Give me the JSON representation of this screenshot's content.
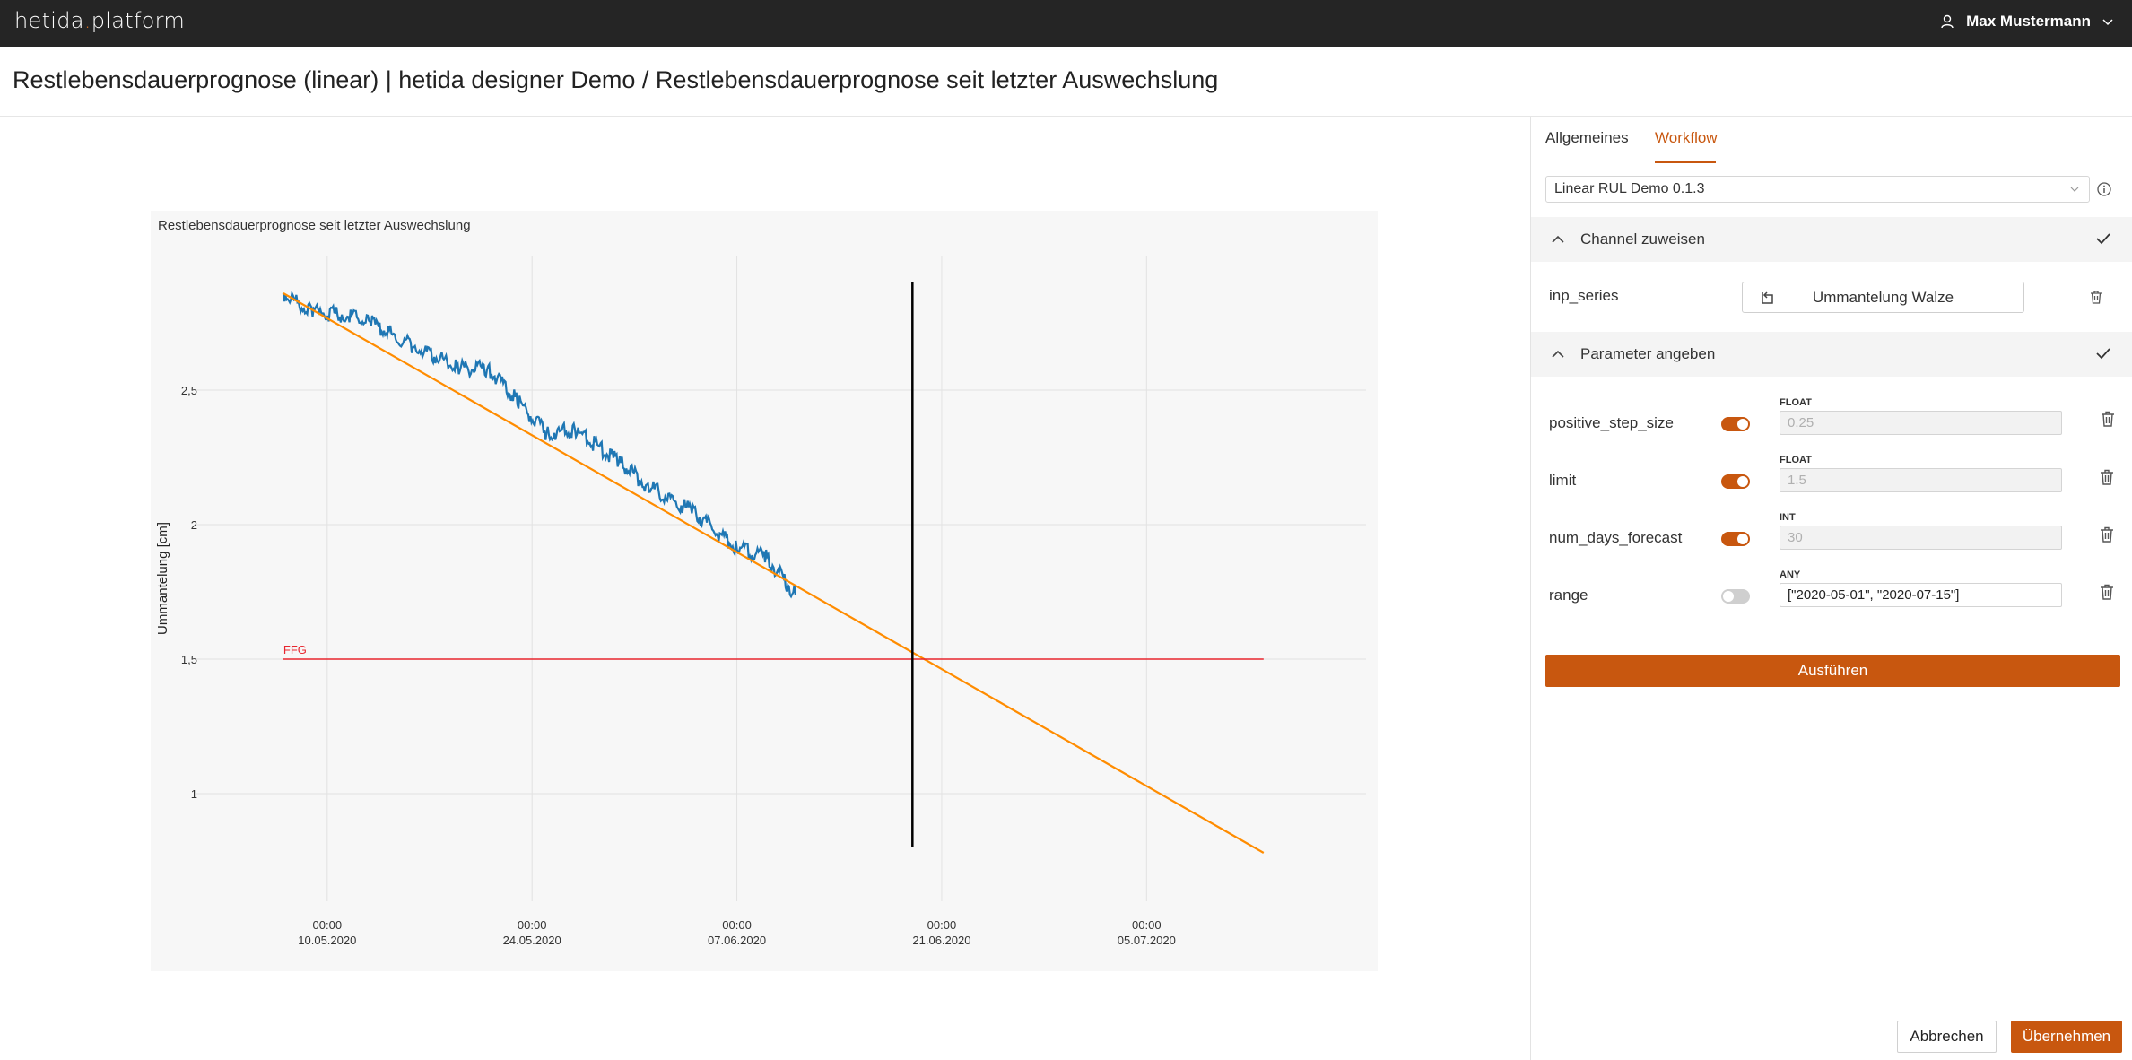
{
  "app": {
    "logo_left": "hetida",
    "logo_dot": ".",
    "logo_right": "platform",
    "user_name": "Max Mustermann",
    "user_icon": "user-icon"
  },
  "page": {
    "title": "Restlebensdauerprognose (linear) | hetida designer Demo / Restlebensdauerprognose seit letzter Auswechslung"
  },
  "chart_data": {
    "type": "line",
    "title": "Restlebensdauerprognose seit letzter Auswechslung",
    "ylabel": "Ummantelung [cm]",
    "xlabel": "",
    "ylim": [
      0.6,
      3.0
    ],
    "grid": true,
    "yticks": [
      {
        "value": 2.5,
        "label": "2,5"
      },
      {
        "value": 2.0,
        "label": "2"
      },
      {
        "value": 1.5,
        "label": "1,5"
      },
      {
        "value": 1.0,
        "label": "1"
      }
    ],
    "xticks": [
      {
        "date": "2020-05-10",
        "time": "00:00",
        "label": "10.05.2020"
      },
      {
        "date": "2020-05-24",
        "time": "00:00",
        "label": "24.05.2020"
      },
      {
        "date": "2020-06-07",
        "time": "00:00",
        "label": "07.06.2020"
      },
      {
        "date": "2020-06-21",
        "time": "00:00",
        "label": "21.06.2020"
      },
      {
        "date": "2020-07-05",
        "time": "00:00",
        "label": "05.07.2020"
      }
    ],
    "xlim": [
      "2020-05-01",
      "2020-07-20"
    ],
    "series": [
      {
        "color": "#1f77b4",
        "style": "noisy",
        "points": [
          {
            "x": "2020-05-07",
            "y": 2.86
          },
          {
            "x": "2020-05-09",
            "y": 2.79
          },
          {
            "x": "2020-05-11",
            "y": 2.78
          },
          {
            "x": "2020-05-13",
            "y": 2.75
          },
          {
            "x": "2020-05-16",
            "y": 2.66
          },
          {
            "x": "2020-05-19",
            "y": 2.58
          },
          {
            "x": "2020-05-21",
            "y": 2.58
          },
          {
            "x": "2020-05-23",
            "y": 2.46
          },
          {
            "x": "2020-05-25",
            "y": 2.34
          },
          {
            "x": "2020-05-27",
            "y": 2.35
          },
          {
            "x": "2020-05-30",
            "y": 2.23
          },
          {
            "x": "2020-06-01",
            "y": 2.14
          },
          {
            "x": "2020-06-04",
            "y": 2.05
          },
          {
            "x": "2020-06-07",
            "y": 1.91
          },
          {
            "x": "2020-06-09",
            "y": 1.88
          },
          {
            "x": "2020-06-11",
            "y": 1.74
          }
        ]
      },
      {
        "color": "#ff8c00",
        "style": "smooth",
        "points": [
          {
            "x": "2020-05-07",
            "y": 2.86
          },
          {
            "x": "2020-07-13",
            "y": 0.78
          }
        ]
      },
      {
        "name": "FFG",
        "color": "#e8262e",
        "style": "smooth",
        "points": [
          {
            "x": "2020-05-07",
            "y": 1.5
          },
          {
            "x": "2020-07-13",
            "y": 1.5
          }
        ]
      }
    ],
    "vertical_marker": {
      "x": "2020-06-19",
      "color": "#000000",
      "ylim": [
        0.8,
        2.9
      ]
    }
  },
  "panel": {
    "tabs": [
      "Allgemeines",
      "Workflow"
    ],
    "active_tab": "Workflow",
    "workflow_select": "Linear RUL Demo 0.1.3",
    "channel_section": "Channel zuweisen",
    "channel_input_label": "inp_series",
    "channel_value": "Ummantelung Walze",
    "param_section": "Parameter angeben",
    "params": [
      {
        "name": "positive_step_size",
        "type": "FLOAT",
        "value": "0.25",
        "enabled": true
      },
      {
        "name": "limit",
        "type": "FLOAT",
        "value": "1.5",
        "enabled": true
      },
      {
        "name": "num_days_forecast",
        "type": "INT",
        "value": "30",
        "enabled": true
      },
      {
        "name": "range",
        "type": "ANY",
        "value": "[\"2020-05-01\", \"2020-07-15\"]",
        "enabled": false
      }
    ],
    "run_button": "Ausführen",
    "cancel_button": "Abbrechen",
    "apply_button": "Übernehmen",
    "accent_color": "#c8570f"
  }
}
